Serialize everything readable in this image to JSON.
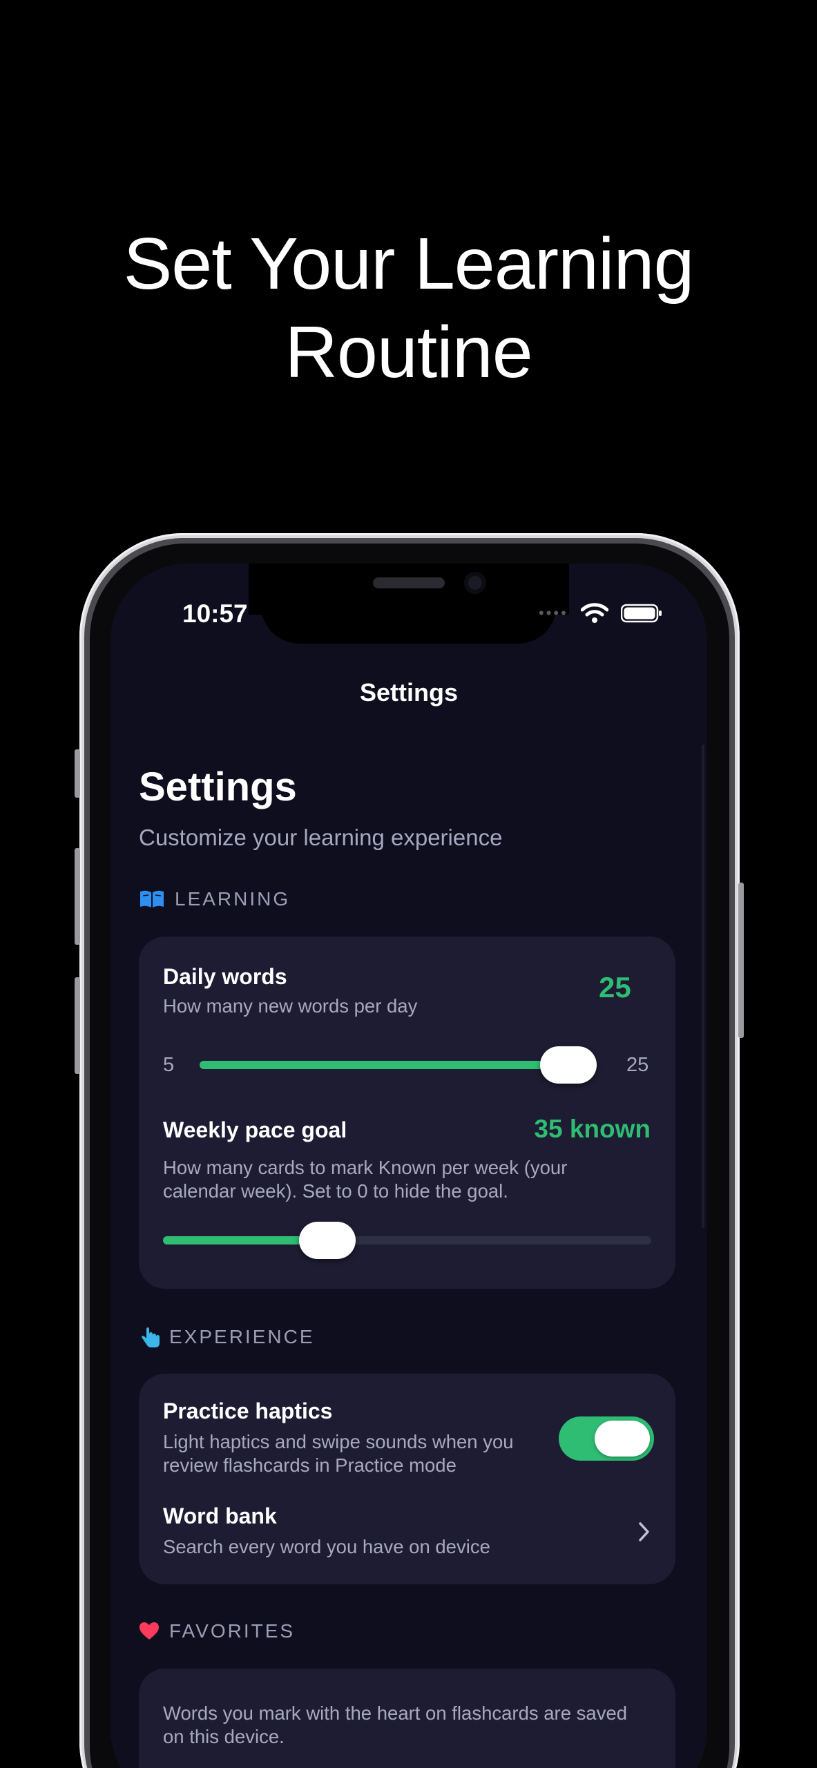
{
  "headline": [
    "Set Your Learning",
    "Routine"
  ],
  "status_bar": {
    "time": "10:57"
  },
  "nav": {
    "title": "Settings"
  },
  "header": {
    "title": "Settings",
    "subtitle": "Customize your learning experience"
  },
  "sections": {
    "learning": {
      "label": "LEARNING",
      "icon": "book-icon",
      "daily_words": {
        "title": "Daily words",
        "description": "How many new words per day",
        "value": "25",
        "slider_min_label": "5",
        "slider_max_label": "25",
        "slider_min": 5,
        "slider_max": 25,
        "slider_value": 25
      },
      "weekly_pace": {
        "title": "Weekly pace goal",
        "value": "35 known",
        "description": "How many cards to mark Known per week (your calendar week). Set to 0 to hide the goal.",
        "slider_fraction": 0.315
      }
    },
    "experience": {
      "label": "EXPERIENCE",
      "icon": "hand-tap-icon",
      "practice_haptics": {
        "title": "Practice haptics",
        "description": "Light haptics and swipe sounds when you review flashcards in Practice mode",
        "enabled": true
      },
      "word_bank": {
        "title": "Word bank",
        "description": "Search every word you have on device"
      }
    },
    "favorites": {
      "label": "FAVORITES",
      "icon": "heart-icon",
      "description": "Words you mark with the heart on flashcards are saved on this device."
    }
  },
  "colors": {
    "accent_green": "#2fbd73",
    "screen_bg": "#0e0e1e",
    "card_bg": "#1d1c32",
    "heart": "#ff3b5c",
    "book": "#2f8ff0",
    "hand": "#3cb6ea"
  }
}
